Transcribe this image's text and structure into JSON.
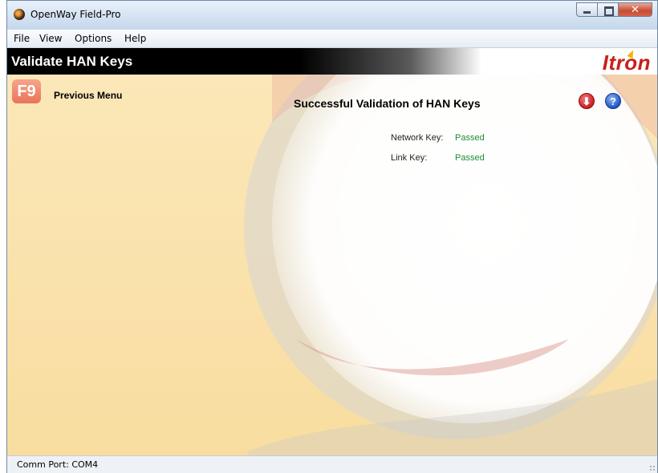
{
  "window": {
    "title": "OpenWay Field-Pro"
  },
  "menu": {
    "items": [
      "File",
      "View",
      "Options",
      "Help"
    ]
  },
  "header": {
    "title": "Validate HAN Keys",
    "logo": "Itron"
  },
  "nav": {
    "f9_label": "F9",
    "previous_menu": "Previous Menu"
  },
  "panel": {
    "title": "Successful Validation of HAN Keys",
    "rows": [
      {
        "label": "Network Key:",
        "value": "Passed"
      },
      {
        "label": "Link Key:",
        "value": "Passed"
      }
    ]
  },
  "status": {
    "text": "Comm Port: COM4"
  },
  "colors": {
    "accent": "#c8201a",
    "passed": "#1c8c2e",
    "background": "#f9dda0"
  }
}
